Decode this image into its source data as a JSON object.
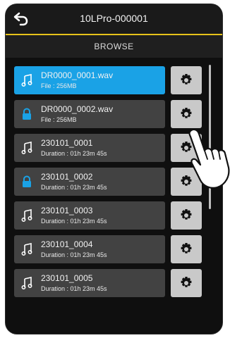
{
  "app": {
    "title": "10LPro-000001"
  },
  "header": {
    "browse_label": "BROWSE"
  },
  "icons": {
    "back": "back-arrow-icon",
    "note": "music-note-icon",
    "lock": "lock-icon",
    "settings": "gear-icon",
    "pointer": "pointing-hand-icon"
  },
  "colors": {
    "accent": "#e6c21a",
    "selected": "#1aa2e6",
    "row": "#424242",
    "lock": "#1aa2e6"
  },
  "items": [
    {
      "name": "DR0000_0001.wav",
      "meta": "File : 256MB",
      "icon": "note",
      "selected": true
    },
    {
      "name": "DR0000_0002.wav",
      "meta": "File : 256MB",
      "icon": "lock",
      "selected": false
    },
    {
      "name": "230101_0001",
      "meta": "Duration : 01h 23m 45s",
      "icon": "note",
      "selected": false
    },
    {
      "name": "230101_0002",
      "meta": "Duration : 01h 23m 45s",
      "icon": "lock",
      "selected": false
    },
    {
      "name": "230101_0003",
      "meta": "Duration : 01h 23m 45s",
      "icon": "note",
      "selected": false
    },
    {
      "name": "230101_0004",
      "meta": "Duration : 01h 23m 45s",
      "icon": "note",
      "selected": false
    },
    {
      "name": "230101_0005",
      "meta": "Duration : 01h 23m 45s",
      "icon": "note",
      "selected": false
    }
  ]
}
